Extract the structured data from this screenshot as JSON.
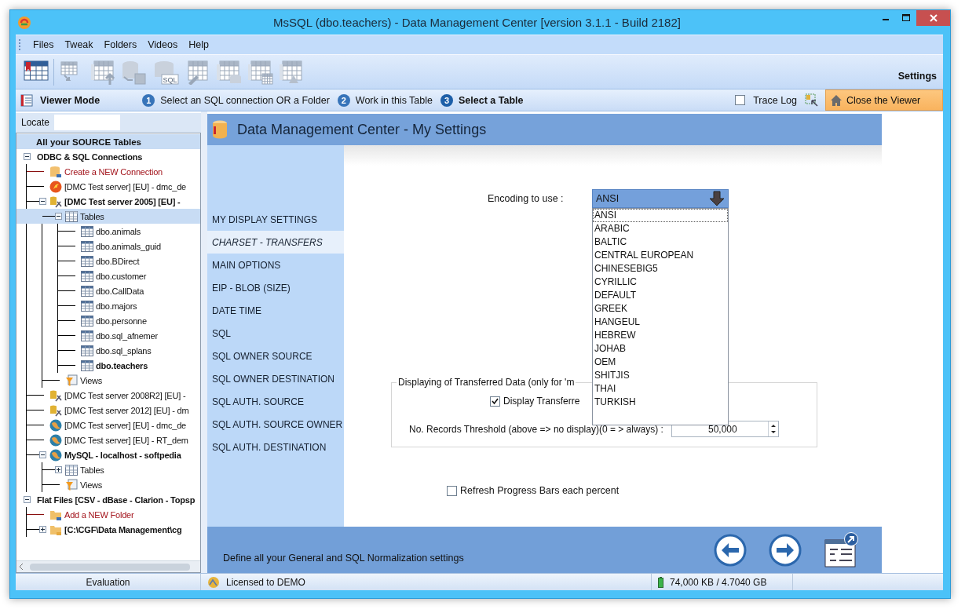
{
  "window": {
    "title": "MsSQL (dbo.teachers) - Data Management Center [version 3.1.1 - Build 2182]"
  },
  "menu": [
    "Files",
    "Tweak",
    "Folders",
    "Videos",
    "Help"
  ],
  "toolbar": {
    "buttons": [
      {
        "kind": "viewer",
        "disabled": false
      },
      {
        "kind": "copy",
        "disabled": true
      },
      {
        "kind": "upload",
        "disabled": true
      },
      {
        "kind": "save",
        "disabled": true
      },
      {
        "kind": "sql",
        "disabled": true,
        "badge": "SQL"
      },
      {
        "kind": "edit",
        "disabled": true
      },
      {
        "kind": "dbtable",
        "disabled": true
      },
      {
        "kind": "multi",
        "disabled": true
      },
      {
        "kind": "warn",
        "disabled": true
      }
    ],
    "settings": "Settings"
  },
  "viewer_bar": {
    "title": "Viewer Mode",
    "steps": [
      {
        "number": "1",
        "label": "Select an SQL connection OR a Folder",
        "selected": false
      },
      {
        "number": "2",
        "label": "Work in this Table",
        "selected": false
      },
      {
        "number": "3",
        "label": "Select a Table",
        "selected": true
      }
    ],
    "trace_log": {
      "label": "Trace Log",
      "checked": false
    },
    "close_button": "Close the Viewer"
  },
  "locate": {
    "label": "Locate"
  },
  "tree": {
    "header": "All your SOURCE Tables",
    "nodes": [
      {
        "label": "ODBC & SQL Connections",
        "kind": "group",
        "bold": true,
        "selected": false,
        "expanded": true,
        "children": [
          {
            "label": "Create a NEW Connection",
            "kind": "new-connection",
            "bold": false,
            "selected": false
          },
          {
            "label": "[DMC Test server] [EU] - dmc_de",
            "kind": "firebird",
            "bold": false,
            "selected": false
          },
          {
            "label": "[DMC Test server 2005] [EU] -",
            "kind": "mssql",
            "bold": true,
            "selected": false,
            "expanded": true,
            "children": [
              {
                "label": "Tables",
                "kind": "tables",
                "bold": false,
                "selected": true,
                "expanded": true,
                "children": [
                  {
                    "label": "dbo.animals",
                    "kind": "table",
                    "bold": false,
                    "selected": false
                  },
                  {
                    "label": "dbo.animals_guid",
                    "kind": "table",
                    "bold": false,
                    "selected": false
                  },
                  {
                    "label": "dbo.BDirect",
                    "kind": "table",
                    "bold": false,
                    "selected": false
                  },
                  {
                    "label": "dbo.customer",
                    "kind": "table",
                    "bold": false,
                    "selected": false
                  },
                  {
                    "label": "dbo.CallData",
                    "kind": "table",
                    "bold": false,
                    "selected": false
                  },
                  {
                    "label": "dbo.majors",
                    "kind": "table",
                    "bold": false,
                    "selected": false
                  },
                  {
                    "label": "dbo.personne",
                    "kind": "table",
                    "bold": false,
                    "selected": false
                  },
                  {
                    "label": "dbo.sql_afnemer",
                    "kind": "table",
                    "bold": false,
                    "selected": false
                  },
                  {
                    "label": "dbo.sql_splans",
                    "kind": "table",
                    "bold": false,
                    "selected": false
                  },
                  {
                    "label": "dbo.teachers",
                    "kind": "table",
                    "bold": true,
                    "selected": false
                  }
                ]
              },
              {
                "label": "Views",
                "kind": "views",
                "bold": false,
                "selected": false
              }
            ]
          },
          {
            "label": "[DMC Test server 2008R2] [EU] -",
            "kind": "mssql",
            "bold": false,
            "selected": false
          },
          {
            "label": "[DMC Test server 2012] [EU] - dm",
            "kind": "mssql",
            "bold": false,
            "selected": false
          },
          {
            "label": "[DMC Test server] [EU] - dmc_de",
            "kind": "mysql",
            "bold": false,
            "selected": false
          },
          {
            "label": "[DMC Test server] [EU] - RT_dem",
            "kind": "mysql",
            "bold": false,
            "selected": false
          },
          {
            "label": "MySQL - localhost - softpedia",
            "kind": "mysql",
            "bold": true,
            "selected": false,
            "expanded": true,
            "children": [
              {
                "label": "Tables",
                "kind": "tables",
                "bold": false,
                "selected": false,
                "expanded": false
              },
              {
                "label": "Views",
                "kind": "views",
                "bold": false,
                "selected": false
              }
            ]
          }
        ]
      },
      {
        "label": "Flat Files [CSV - dBase - Clarion - Topsp",
        "kind": "group",
        "bold": true,
        "selected": false,
        "expanded": true,
        "children": [
          {
            "label": "Add a NEW Folder",
            "kind": "new-folder",
            "bold": false,
            "selected": false
          },
          {
            "label": "[C:\\CGF\\Data Management\\cg",
            "kind": "folder",
            "bold": true,
            "selected": false,
            "expanded": false
          }
        ]
      }
    ]
  },
  "settings": {
    "title": "Data Management Center - My Settings",
    "nav": [
      {
        "label": "MY DISPLAY SETTINGS",
        "selected": false
      },
      {
        "label": "CHARSET - TRANSFERS",
        "selected": true
      },
      {
        "label": "MAIN OPTIONS",
        "selected": false
      },
      {
        "label": "EIP - BLOB (SIZE)",
        "selected": false
      },
      {
        "label": "DATE  TIME",
        "selected": false
      },
      {
        "label": "SQL",
        "selected": false
      },
      {
        "label": "SQL OWNER SOURCE",
        "selected": false
      },
      {
        "label": "SQL OWNER DESTINATION",
        "selected": false
      },
      {
        "label": "SQL AUTH. SOURCE",
        "selected": false
      },
      {
        "label": "SQL AUTH. SOURCE OWNER",
        "selected": false
      },
      {
        "label": "SQL AUTH. DESTINATION",
        "selected": false
      }
    ],
    "encoding": {
      "label": "Encoding to use :",
      "value": "ANSI",
      "options": [
        {
          "label": "ANSI",
          "selected": true
        },
        {
          "label": "ARABIC",
          "selected": false
        },
        {
          "label": "BALTIC",
          "selected": false
        },
        {
          "label": "CENTRAL EUROPEAN",
          "selected": false
        },
        {
          "label": "CHINESEBIG5",
          "selected": false
        },
        {
          "label": "CYRILLIC",
          "selected": false
        },
        {
          "label": "DEFAULT",
          "selected": false
        },
        {
          "label": "GREEK",
          "selected": false
        },
        {
          "label": "HANGEUL",
          "selected": false
        },
        {
          "label": "HEBREW",
          "selected": false
        },
        {
          "label": "JOHAB",
          "selected": false
        },
        {
          "label": "OEM",
          "selected": false
        },
        {
          "label": "SHITJIS",
          "selected": false
        },
        {
          "label": "THAI",
          "selected": false
        },
        {
          "label": "TURKISH",
          "selected": false
        }
      ]
    },
    "transfer_group": {
      "legend": "Displaying of Transferred Data (only for 'm",
      "display_check": {
        "label": "Display Transferre",
        "checked": true
      },
      "threshold": {
        "label": "No. Records Threshold (above => no display)(0 = > always) :",
        "value": "50,000"
      }
    },
    "refresh": {
      "label": "Refresh Progress Bars each percent",
      "checked": false
    },
    "footer": "Define all your General and SQL Normalization settings"
  },
  "status_bar": {
    "edition": "Evaluation",
    "license": "Licensed to DEMO",
    "memory": "74,000 KB /  4.7040 GB"
  }
}
